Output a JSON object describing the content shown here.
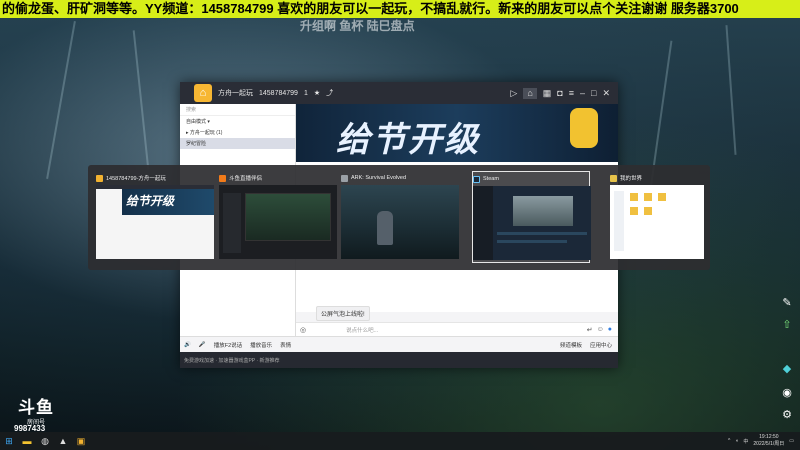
{
  "ticker": "的偷龙蛋、肝矿洞等等。YY频道：1458784799 喜欢的朋友可以一起玩，不搞乱就行。新来的朋友可以点个关注谢谢   服务器3700",
  "subtitle": "升组啊 鱼杯 陆巳盘点",
  "client": {
    "title_channel": "方舟一起玩",
    "title_id": "1458784799",
    "title_count": "1",
    "banner_text": "给节开级",
    "left_panel": {
      "search_placeholder": "搜索",
      "rows": [
        "自由模式 ▾",
        "▸ 方舟一起玩 (1)",
        "罗纪冒险"
      ]
    },
    "notice": "公屏气泡上线啦!",
    "input_placeholder": "说点什么吧...",
    "bottom_bar": [
      "播放F2说话",
      "播放音乐",
      "表情"
    ],
    "bottom_bar_right": [
      "频道模板",
      "应用中心"
    ],
    "status_text": "免费游戏加速 · 加速器游戏盒PP · 新游推荐"
  },
  "alttab": {
    "tiles": [
      {
        "title": "1458784799-方舟一起玩",
        "icon_color": "#f2b230"
      },
      {
        "title": "斗鱼直播伴侣",
        "icon_color": "#f27b1a"
      },
      {
        "title": "ARK: Survival Evolved",
        "icon_color": "#9aa0a6"
      },
      {
        "title": "Steam",
        "icon_color": "#1b2838",
        "selected": true
      },
      {
        "title": "我的世界",
        "icon_color": "#e6c24a"
      }
    ]
  },
  "douyu": {
    "logo": "斗鱼",
    "sub": "房间号",
    "room": "9987433"
  },
  "taskbar": {
    "time": "19:12:50",
    "date": "2022/5/1/周日",
    "ime": "中",
    "apps": [
      "start-icon",
      "folder-icon",
      "steam-icon",
      "ark-icon",
      "yy-icon"
    ]
  }
}
